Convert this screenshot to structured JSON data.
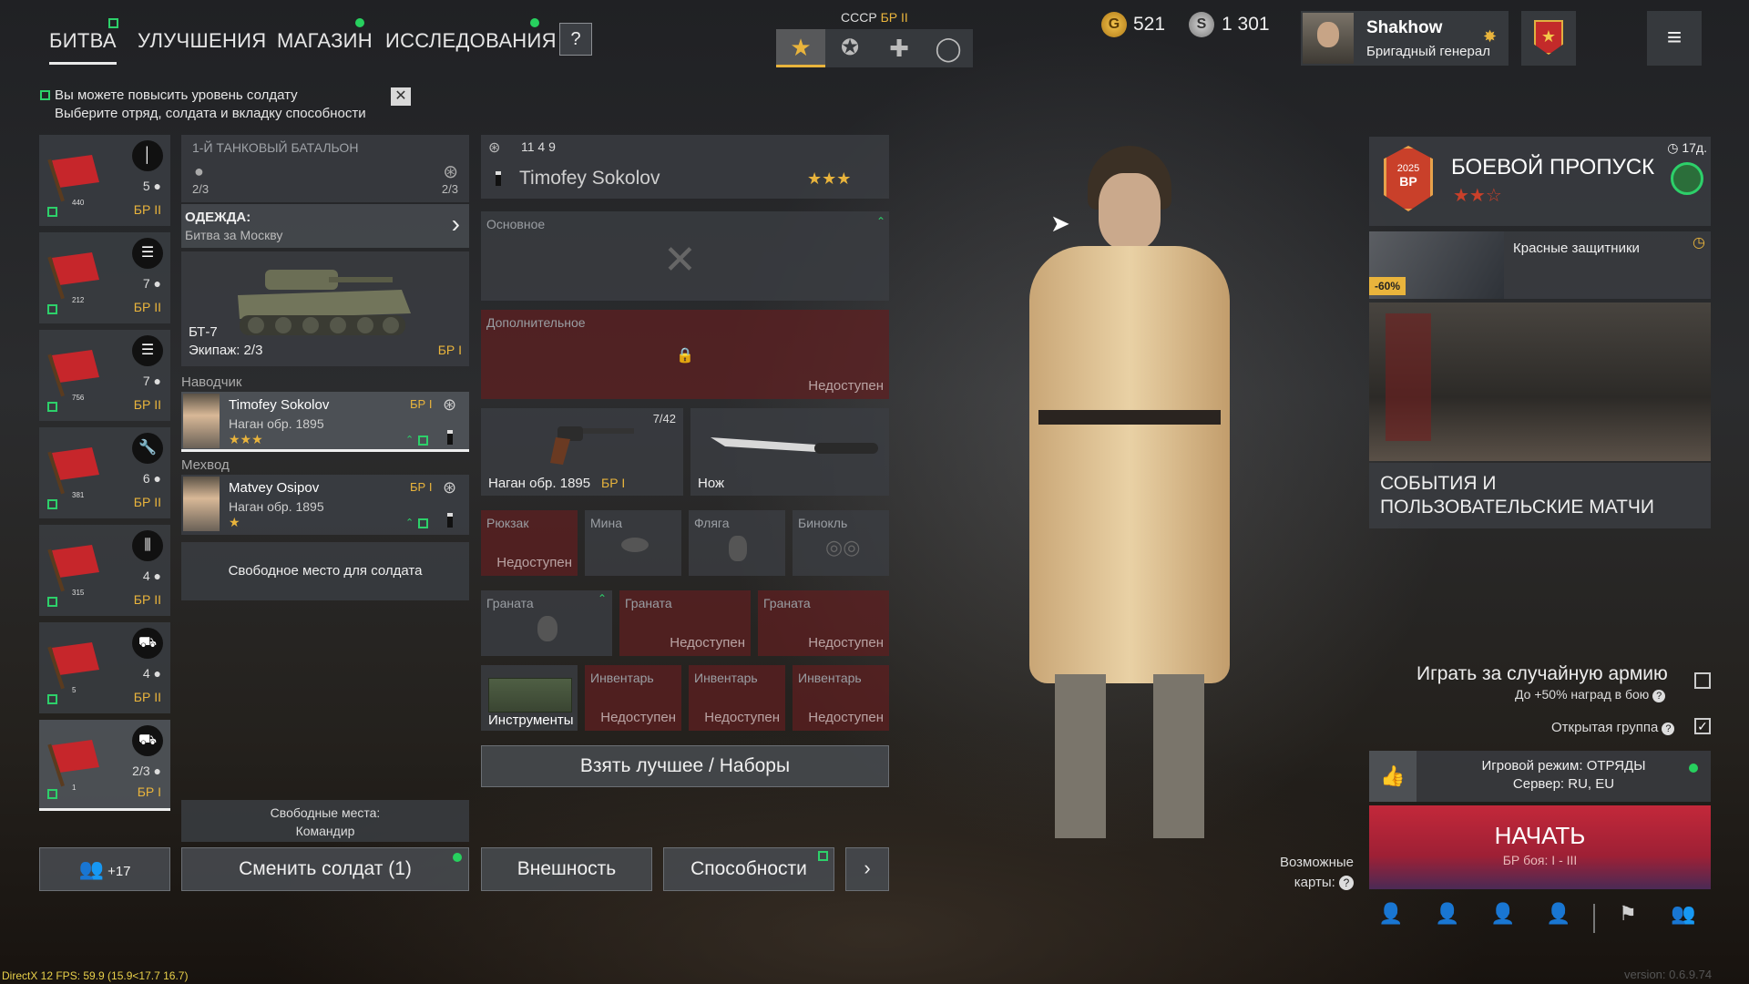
{
  "nav": {
    "tabs": [
      {
        "label": "БИТВА",
        "active": true
      },
      {
        "label": "УЛУЧШЕНИЯ"
      },
      {
        "label": "МАГАЗИН"
      },
      {
        "label": "ИССЛЕДОВАНИЯ"
      }
    ],
    "help_label": "?"
  },
  "army": {
    "nation": "СССР",
    "br": "БР II",
    "selector_icons": [
      "star-icon",
      "star-circle-icon",
      "cross-icon",
      "circle-icon"
    ]
  },
  "currency": {
    "gold": "521",
    "silver": "1 301"
  },
  "player": {
    "name": "Shakhow",
    "rank": "Бригадный генерал"
  },
  "hint": {
    "line1": "Вы можете повысить уровень солдату",
    "line2": "Выберите отряд, солдата и вкладку способности"
  },
  "squads": [
    {
      "num": "440",
      "icon": "pen-icon",
      "count": "5",
      "br": "БР II"
    },
    {
      "num": "212",
      "icon": "list-icon",
      "count": "7",
      "br": "БР II"
    },
    {
      "num": "756",
      "icon": "list-icon",
      "count": "7",
      "br": "БР II"
    },
    {
      "num": "381",
      "icon": "wrench-icon",
      "count": "6",
      "br": "БР II"
    },
    {
      "num": "315",
      "icon": "ammo-icon",
      "count": "4",
      "br": "БР II"
    },
    {
      "num": "5",
      "icon": "vehicle-icon",
      "count": "4",
      "br": "БР II"
    },
    {
      "num": "1",
      "icon": "tank-icon",
      "count": "2/3",
      "br": "БР I"
    }
  ],
  "squad_detail": {
    "title": "1-Й ТАНКОВЫЙ БАТАЛЬОН",
    "soldiers": "2/3",
    "crew": "2/3",
    "clothing_label": "ОДЕЖДА:",
    "clothing_value": "Битва за Москву",
    "vehicle_name": "БТ-7",
    "vehicle_crew": "Экипаж: 2/3",
    "vehicle_br": "БР I",
    "role1": "Наводчик",
    "soldier1": {
      "name": "Timofey Sokolov",
      "weapon": "Наган обр. 1895",
      "br": "БР I",
      "stars": "★★★"
    },
    "role2": "Мехвод",
    "soldier2": {
      "name": "Matvey Osipov",
      "weapon": "Наган обр. 1895",
      "br": "БР I",
      "stars": "★"
    },
    "free_slot": "Свободное место для солдата",
    "free_places_line1": "Свободные места:",
    "free_places_line2": "Командир"
  },
  "soldier": {
    "stats": "11  4  9",
    "name": "Timofey Sokolov",
    "stars": "★★★",
    "primary_label": "Основное",
    "secondary_label": "Дополнительное",
    "unavailable": "Недоступен",
    "sidearm": "Наган обр. 1895",
    "sidearm_br": "БР I",
    "sidearm_ammo": "7/42",
    "melee": "Нож",
    "backpack": "Рюкзак",
    "mine": "Мина",
    "flask": "Фляга",
    "binoculars": "Бинокль",
    "grenade": "Граната",
    "tools": "Инструменты",
    "inventory": "Инвентарь",
    "take_best": "Взять лучшее / Наборы"
  },
  "bottom_buttons": {
    "reserve": "+17",
    "change_soldier": "Сменить солдат (1)",
    "appearance": "Внешность",
    "abilities": "Способности"
  },
  "battlepass": {
    "title": "БОЕВОЙ ПРОПУСК",
    "timer": "17д.",
    "stars": "★★☆",
    "badge_year": "2025",
    "badge_text": "BP",
    "offer_title": "Красные защитники",
    "discount": "-60%",
    "events_title": "СОБЫТИЯ И ПОЛЬЗОВАТЕЛЬСКИЕ МАТЧИ"
  },
  "match": {
    "random_army": "Играть за случайную армию",
    "random_army_bonus": "До +50% наград в бою",
    "open_group": "Открытая группа",
    "mode": "Игровой режим: ОТРЯДЫ",
    "server": "Сервер: RU, EU",
    "start": "НАЧАТЬ",
    "start_br": "БР боя: I - III",
    "maps_line1": "Возможные",
    "maps_line2": "карты:"
  },
  "debug": {
    "fps": "DirectX 12 FPS: 59.9 (15.9<17.7 16.7)",
    "version": "version: 0.6.9.74"
  },
  "colors": {
    "gold": "#e9b43c",
    "green": "#2dd06a",
    "start_red": "#c0283a"
  }
}
